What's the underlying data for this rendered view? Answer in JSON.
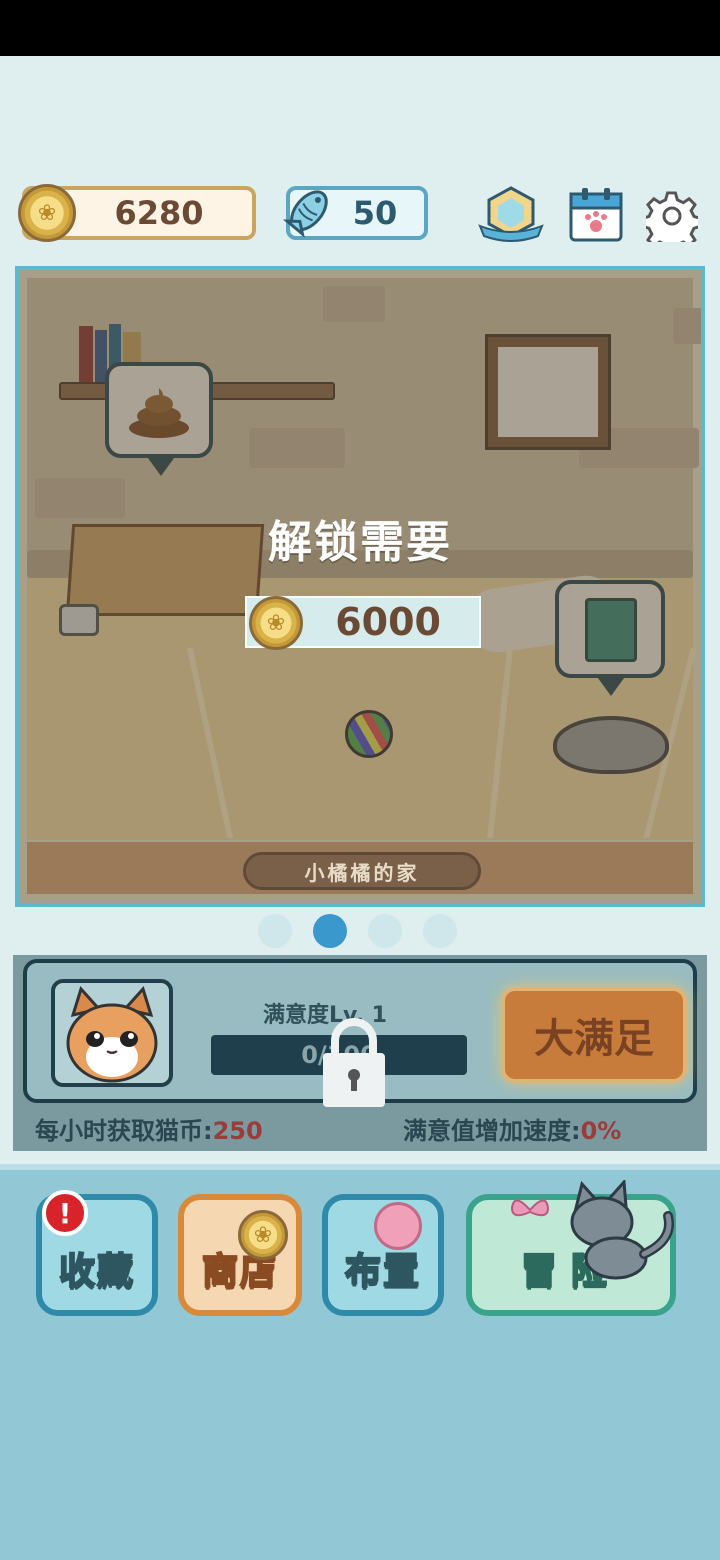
{
  "currency": {
    "coins": "6280",
    "fish": "50"
  },
  "room": {
    "unlock_title": "解锁需要",
    "unlock_price": "6000",
    "name": "小橘橘的家"
  },
  "pager": {
    "total": 4,
    "active": 1
  },
  "satisfaction": {
    "label": "满意度Lv. 1",
    "progress_text": "0/100",
    "big_button": "大满足",
    "coins_per_hour_label": "每小时获取猫币:",
    "coins_per_hour_value": "250",
    "speed_label": "满意值增加速度:",
    "speed_value": "0%"
  },
  "nav": {
    "collect": "收藏",
    "shop": "商店",
    "layout": "布置",
    "adventure": "冒险",
    "alert": "!"
  },
  "colors": {
    "accent_blue": "#3a98cc",
    "coin_text": "#6b4a35",
    "stat_value": "#9b3b3b"
  }
}
